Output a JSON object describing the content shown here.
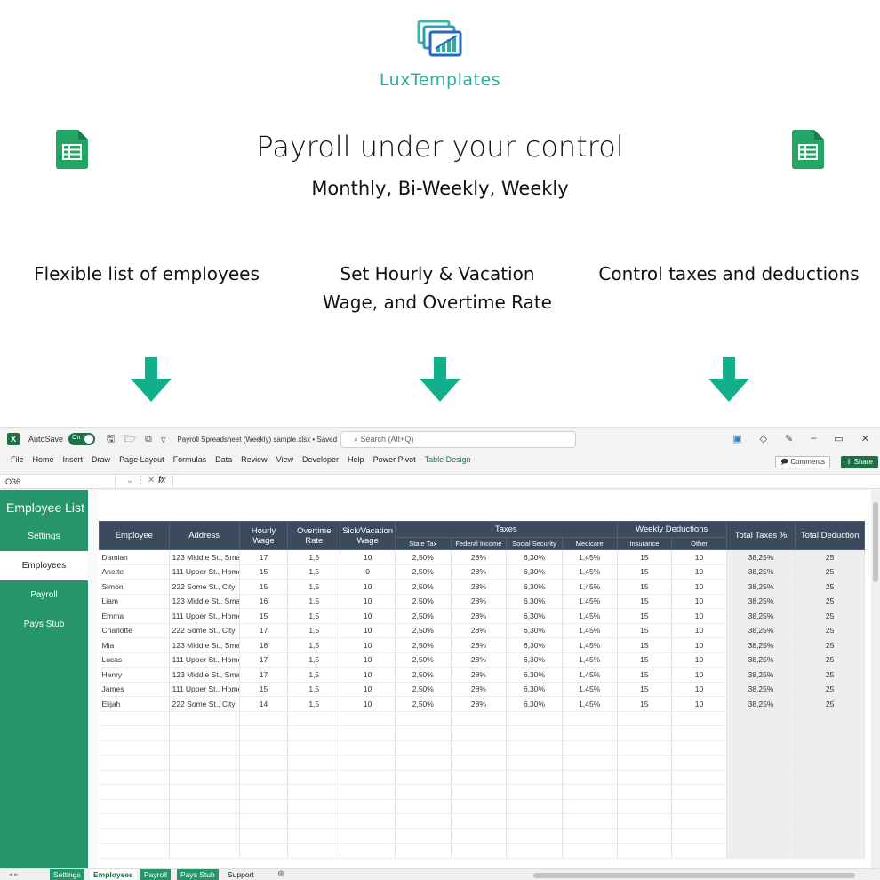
{
  "promo": {
    "brand": "LuxTemplates",
    "headline": "Payroll under your control",
    "subline": "Monthly, Bi-Weekly, Weekly",
    "features": [
      {
        "lines": [
          "Flexible list of employees"
        ]
      },
      {
        "lines": [
          "Set Hourly & Vacation",
          "Wage, and Overtime Rate"
        ]
      },
      {
        "lines": [
          "Control taxes and deductions"
        ]
      }
    ],
    "arrow_color": "#12b08a",
    "sheet_icon_color": "#23a566"
  },
  "excel": {
    "autosave_label": "AutoSave",
    "autosave_state": "On",
    "filename": "Payroll Spreadsheet (Weekly) sample.xlsx • Saved ⌄",
    "search_placeholder": "Search (Alt+Q)",
    "menu": [
      "File",
      "Home",
      "Insert",
      "Draw",
      "Page Layout",
      "Formulas",
      "Data",
      "Review",
      "View",
      "Developer",
      "Help",
      "Power Pivot",
      "Table Design"
    ],
    "comments_label": "Comments",
    "share_label": "Share",
    "name_box": "O36",
    "fx": "fx",
    "sidebar": {
      "title": "Employee List",
      "items": [
        "Settings",
        "Employees",
        "Payroll",
        "Pays Stub"
      ],
      "active": "Employees"
    },
    "table": {
      "headers": {
        "employee": "Employee",
        "address": "Address",
        "hourly_wage": "Hourly Wage",
        "overtime_rate": "Overtime Rate",
        "sick_vacation": "Sick/Vacation Wage",
        "taxes": "Taxes",
        "state_tax": "State Tax",
        "federal_income": "Federal Income",
        "social_security": "Social Security",
        "medicare": "Medicare",
        "weekly_deductions": "Weekly Deductions",
        "insurance": "Insurance",
        "other": "Other",
        "total_taxes": "Total Taxes %",
        "total_deduction": "Total Deduction"
      },
      "rows": [
        [
          "Damian",
          "123 Middle St., Sma",
          "17",
          "1,5",
          "10",
          "2,50%",
          "28%",
          "6,30%",
          "1,45%",
          "15",
          "10",
          "38,25%",
          "25"
        ],
        [
          "Anette",
          "111 Upper St., Home",
          "15",
          "1,5",
          "0",
          "2,50%",
          "28%",
          "6,30%",
          "1,45%",
          "15",
          "10",
          "38,25%",
          "25"
        ],
        [
          "Simon",
          "222 Some St., City",
          "15",
          "1,5",
          "10",
          "2,50%",
          "28%",
          "6,30%",
          "1,45%",
          "15",
          "10",
          "38,25%",
          "25"
        ],
        [
          "Liam",
          "123 Middle St., Sma",
          "16",
          "1,5",
          "10",
          "2,50%",
          "28%",
          "6,30%",
          "1,45%",
          "15",
          "10",
          "38,25%",
          "25"
        ],
        [
          "Emma",
          "111 Upper St., Home",
          "15",
          "1,5",
          "10",
          "2,50%",
          "28%",
          "6,30%",
          "1,45%",
          "15",
          "10",
          "38,25%",
          "25"
        ],
        [
          "Charlotte",
          "222 Some St., City",
          "17",
          "1,5",
          "10",
          "2,50%",
          "28%",
          "6,30%",
          "1,45%",
          "15",
          "10",
          "38,25%",
          "25"
        ],
        [
          "Mia",
          "123 Middle St., Sma",
          "18",
          "1,5",
          "10",
          "2,50%",
          "28%",
          "6,30%",
          "1,45%",
          "15",
          "10",
          "38,25%",
          "25"
        ],
        [
          "Lucas",
          "111 Upper St., Home",
          "17",
          "1,5",
          "10",
          "2,50%",
          "28%",
          "6,30%",
          "1,45%",
          "15",
          "10",
          "38,25%",
          "25"
        ],
        [
          "Henry",
          "123 Middle St., Sma",
          "17",
          "1,5",
          "10",
          "2,50%",
          "28%",
          "6,30%",
          "1,45%",
          "15",
          "10",
          "38,25%",
          "25"
        ],
        [
          "James",
          "111 Upper St., Home",
          "15",
          "1,5",
          "10",
          "2,50%",
          "28%",
          "6,30%",
          "1,45%",
          "15",
          "10",
          "38,25%",
          "25"
        ],
        [
          "Elijah",
          "222 Some St., City",
          "14",
          "1,5",
          "10",
          "2,50%",
          "28%",
          "6,30%",
          "1,45%",
          "15",
          "10",
          "38,25%",
          "25"
        ]
      ],
      "empty_rows": 10
    },
    "tabs": [
      "Settings",
      "Employees",
      "Payroll",
      "Pays Stub",
      "Support"
    ],
    "active_tab": "Employees",
    "accent": "#26956b",
    "header_bg": "#3b4a5c"
  }
}
